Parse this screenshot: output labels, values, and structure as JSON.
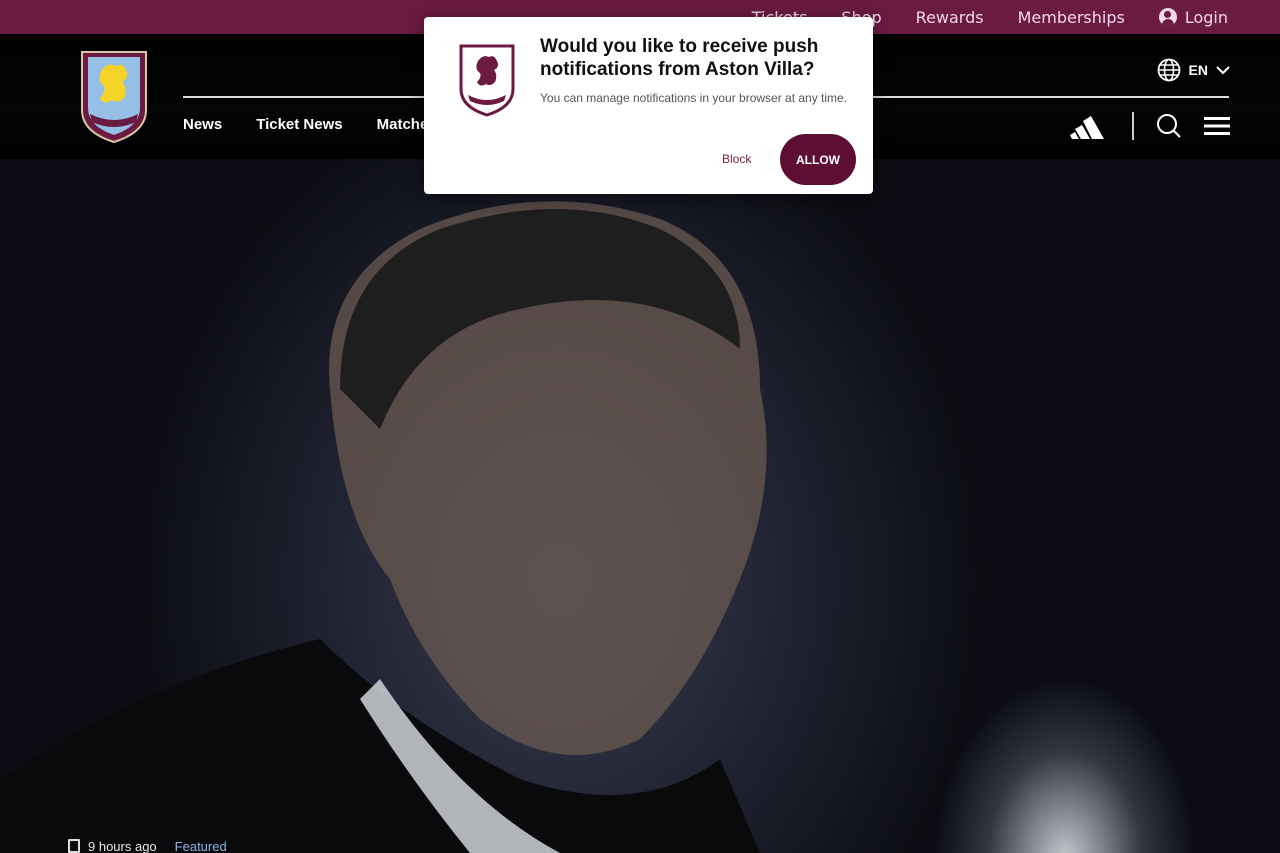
{
  "utility_bar": {
    "links": [
      "Tickets",
      "Shop",
      "Rewards",
      "Memberships"
    ],
    "login_label": "Login"
  },
  "header": {
    "crest_text": "ASTON VILLA",
    "nav": [
      "News",
      "Ticket News",
      "Matches"
    ],
    "language": "EN"
  },
  "push_popup": {
    "title": "Would you like to receive push notifications from Aston Villa?",
    "description": "You can manage notifications in your browser at any time.",
    "block_label": "Block",
    "allow_label": "ALLOW"
  },
  "hero": {
    "time_ago": "9 hours ago",
    "category": "Featured"
  },
  "colors": {
    "brand_claret": "#6b1a42",
    "allow_button": "#5e0e33",
    "crest_sky_blue": "#95bfe5",
    "crest_yellow": "#f5d327"
  }
}
